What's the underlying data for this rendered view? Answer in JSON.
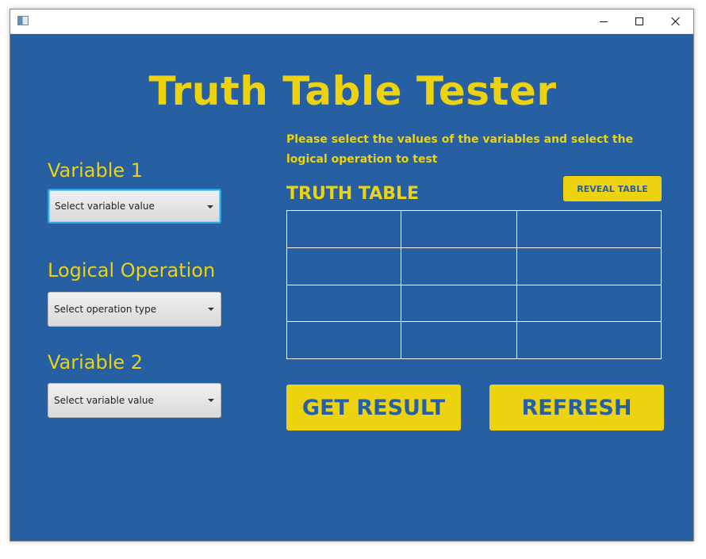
{
  "window": {
    "title": "",
    "controls": {
      "minimize_icon": "minimize-icon",
      "maximize_icon": "maximize-icon",
      "close_icon": "close-icon"
    }
  },
  "main": {
    "title": "Truth Table Tester",
    "variable1": {
      "label": "Variable 1",
      "placeholder": "Select variable value"
    },
    "operation": {
      "label": "Logical Operation",
      "placeholder": "Select operation type"
    },
    "variable2": {
      "label": "Variable 2",
      "placeholder": "Select variable value"
    },
    "instructions": "Please select the values of the variables and select the logical operation to test",
    "truth_table": {
      "title": "TRUTH TABLE",
      "reveal_label": "REVEAL TABLE",
      "rows": [
        [
          "",
          "",
          ""
        ],
        [
          "",
          "",
          ""
        ],
        [
          "",
          "",
          ""
        ],
        [
          "",
          "",
          ""
        ]
      ]
    },
    "buttons": {
      "get_result": "GET RESULT",
      "refresh": "REFRESH"
    }
  },
  "colors": {
    "background": "#2660a3",
    "accent": "#ecd20f",
    "focus": "#2aa8e8"
  }
}
